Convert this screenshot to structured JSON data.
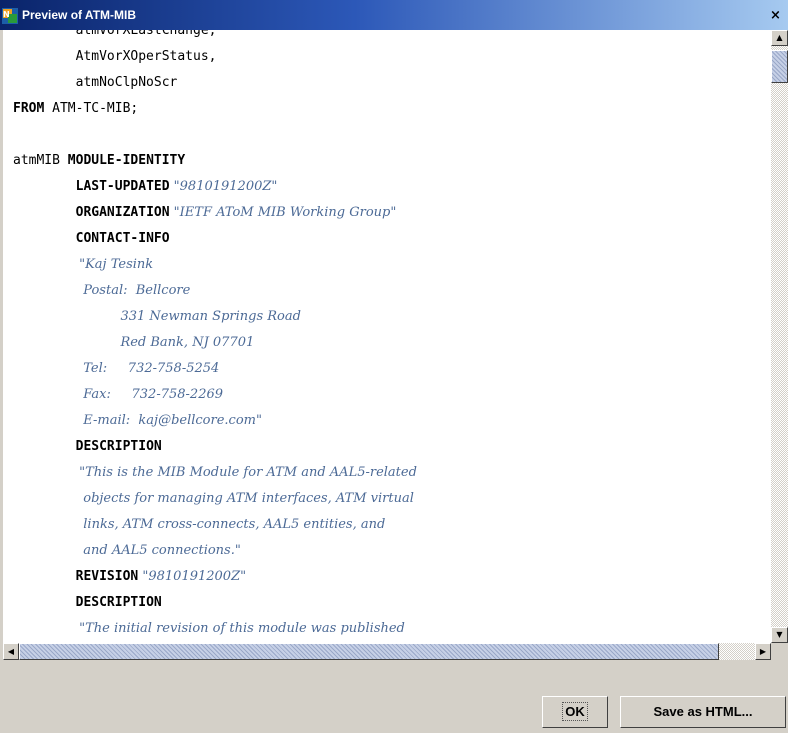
{
  "window": {
    "title": "Preview of ATM-MIB",
    "close_glyph": "×"
  },
  "code_lines": [
    [
      {
        "t": "        atmVorXLastChange,",
        "s": "plain"
      }
    ],
    [
      {
        "t": "        AtmVorXOperStatus,",
        "s": "plain"
      }
    ],
    [
      {
        "t": "        atmNoClpNoScr",
        "s": "plain"
      }
    ],
    [
      {
        "t": "FROM",
        "s": "kw"
      },
      {
        "t": " ATM-TC-MIB;",
        "s": "plain"
      }
    ],
    [
      {
        "t": "",
        "s": "plain"
      }
    ],
    [
      {
        "t": "atmMIB ",
        "s": "plain"
      },
      {
        "t": "MODULE-IDENTITY",
        "s": "kw"
      }
    ],
    [
      {
        "t": "        ",
        "s": "plain"
      },
      {
        "t": "LAST-UPDATED",
        "s": "kw"
      },
      {
        "t": " \"9810191200Z\"",
        "s": "str"
      }
    ],
    [
      {
        "t": "        ",
        "s": "plain"
      },
      {
        "t": "ORGANIZATION",
        "s": "kw"
      },
      {
        "t": " \"IETF AToM MIB Working Group\"",
        "s": "str"
      }
    ],
    [
      {
        "t": "        ",
        "s": "plain"
      },
      {
        "t": "CONTACT-INFO",
        "s": "kw"
      }
    ],
    [
      {
        "t": "                \"Kaj Tesink",
        "s": "str"
      }
    ],
    [
      {
        "t": "                 Postal:  Bellcore",
        "s": "str"
      }
    ],
    [
      {
        "t": "                          331 Newman Springs Road",
        "s": "str"
      }
    ],
    [
      {
        "t": "                          Red Bank, NJ 07701",
        "s": "str"
      }
    ],
    [
      {
        "t": "                 Tel:     732-758-5254",
        "s": "str"
      }
    ],
    [
      {
        "t": "                 Fax:     732-758-2269",
        "s": "str"
      }
    ],
    [
      {
        "t": "                 E-mail:  kaj@bellcore.com\"",
        "s": "str"
      }
    ],
    [
      {
        "t": "        ",
        "s": "plain"
      },
      {
        "t": "DESCRIPTION",
        "s": "kw"
      }
    ],
    [
      {
        "t": "                \"This is the MIB Module for ATM and AAL5-related",
        "s": "str"
      }
    ],
    [
      {
        "t": "                 objects for managing ATM interfaces, ATM virtual",
        "s": "str"
      }
    ],
    [
      {
        "t": "                 links, ATM cross-connects, AAL5 entities, and",
        "s": "str"
      }
    ],
    [
      {
        "t": "                 and AAL5 connections.\"",
        "s": "str"
      }
    ],
    [
      {
        "t": "        ",
        "s": "plain"
      },
      {
        "t": "REVISION",
        "s": "kw"
      },
      {
        "t": " \"9810191200Z\"",
        "s": "str"
      }
    ],
    [
      {
        "t": "        ",
        "s": "plain"
      },
      {
        "t": "DESCRIPTION",
        "s": "kw"
      }
    ],
    [
      {
        "t": "                \"The initial revision of this module was published",
        "s": "str"
      }
    ]
  ],
  "scrollbars": {
    "up_arrow": "▲",
    "down_arrow": "▼",
    "left_arrow": "◀",
    "right_arrow": "▶"
  },
  "buttons": {
    "ok_label": "OK",
    "save_label": "Save as HTML..."
  },
  "colors": {
    "keyword": "#000000",
    "string": "#4c6a96",
    "titlebar_start": "#0a246a",
    "titlebar_end": "#a6caf0"
  }
}
